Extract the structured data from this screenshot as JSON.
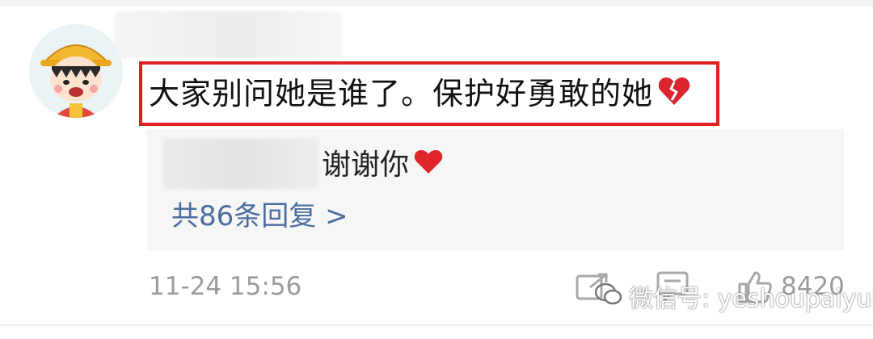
{
  "comment": {
    "text": "大家别问她是谁了。保护好勇敢的她",
    "emoji": "broken-heart-icon"
  },
  "reply": {
    "text": "谢谢你",
    "emoji": "heart-icon"
  },
  "more_replies_label": "共86条回复 >",
  "timestamp": "11-24 15:56",
  "likes": "8420",
  "watermark": "微信号: yeshoupaiyule",
  "colors": {
    "highlight_border": "#e0201f",
    "link": "#4c6e9e",
    "muted": "#9b9b9b",
    "reply_bg": "#f6f6f7"
  }
}
